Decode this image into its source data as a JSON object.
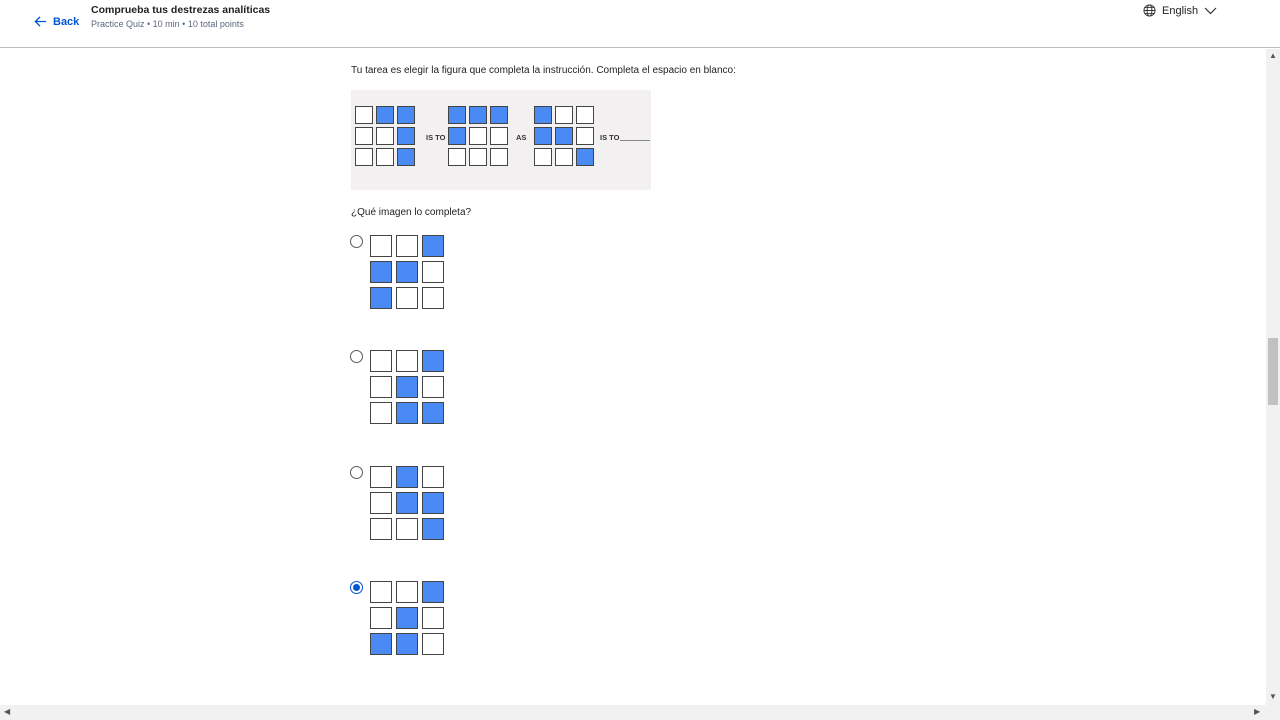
{
  "header": {
    "back_label": "Back",
    "title": "Comprueba tus destrezas analíticas",
    "subtitle": "Practice Quiz • 10 min • 10 total points",
    "language": "English"
  },
  "question": {
    "instruction": "Tu tarea es elegir la figura que completa la instrucción. Completa el espacio en blanco:",
    "analogy": {
      "words": [
        "IS TO",
        "AS",
        "IS TO"
      ],
      "figures": [
        [
          0,
          1,
          1,
          0,
          0,
          1,
          0,
          0,
          1
        ],
        [
          1,
          1,
          1,
          1,
          0,
          0,
          0,
          0,
          0
        ],
        [
          1,
          0,
          0,
          1,
          1,
          0,
          0,
          0,
          1
        ]
      ]
    },
    "prompt": "¿Qué imagen lo completa?",
    "options": [
      {
        "cells": [
          0,
          0,
          1,
          1,
          1,
          0,
          1,
          0,
          0
        ],
        "selected": false
      },
      {
        "cells": [
          0,
          0,
          1,
          0,
          1,
          0,
          0,
          1,
          1
        ],
        "selected": false
      },
      {
        "cells": [
          0,
          1,
          0,
          0,
          1,
          1,
          0,
          0,
          1
        ],
        "selected": false
      },
      {
        "cells": [
          0,
          0,
          1,
          0,
          1,
          0,
          1,
          1,
          0
        ],
        "selected": true
      }
    ]
  },
  "colors": {
    "accent": "#0056d2",
    "filled_cell": "#4a8af4"
  }
}
